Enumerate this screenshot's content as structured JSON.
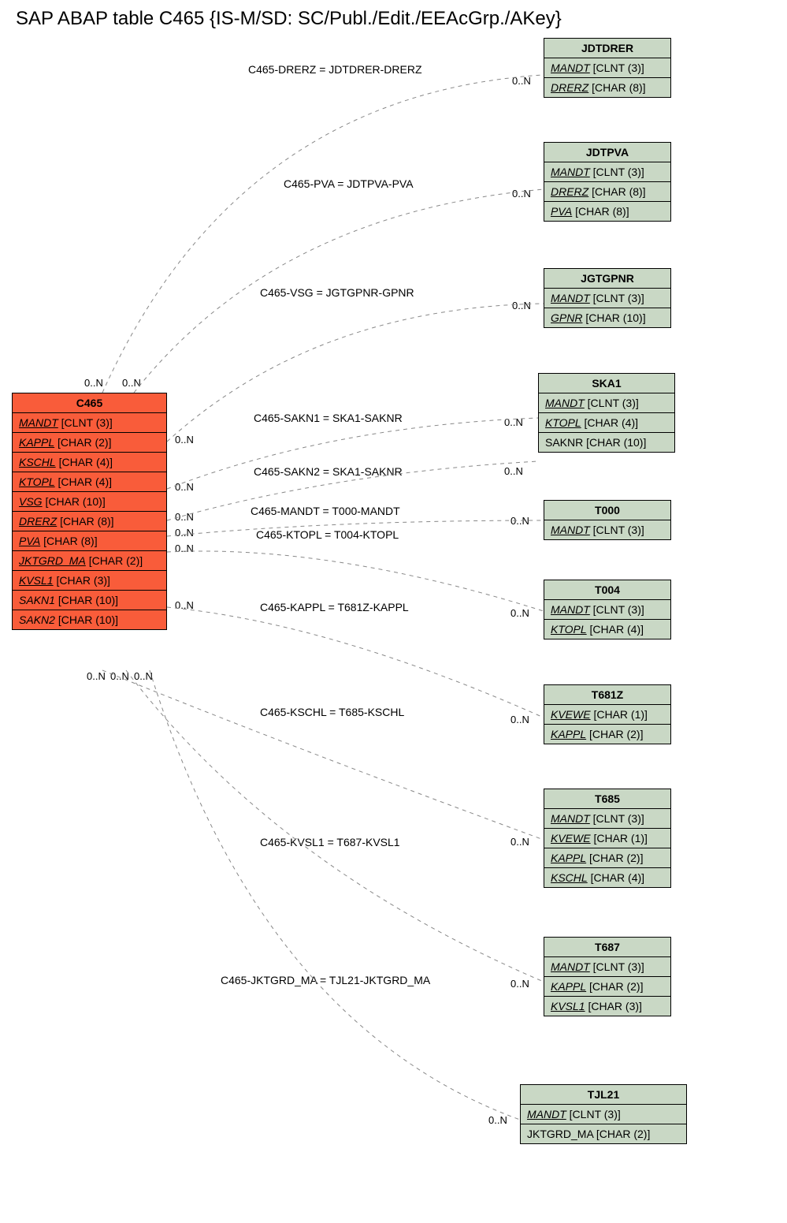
{
  "title": "SAP ABAP table C465 {IS-M/SD: SC/Publ./Edit./EEAcGrp./AKey}",
  "main_entity": {
    "name": "C465",
    "fields": [
      {
        "name": "MANDT",
        "type": "[CLNT (3)]",
        "key": true
      },
      {
        "name": "KAPPL",
        "type": "[CHAR (2)]",
        "key": true
      },
      {
        "name": "KSCHL",
        "type": "[CHAR (4)]",
        "key": true
      },
      {
        "name": "KTOPL",
        "type": "[CHAR (4)]",
        "key": true
      },
      {
        "name": "VSG",
        "type": "[CHAR (10)]",
        "key": true
      },
      {
        "name": "DRERZ",
        "type": "[CHAR (8)]",
        "key": true
      },
      {
        "name": "PVA",
        "type": "[CHAR (8)]",
        "key": true
      },
      {
        "name": "JKTGRD_MA",
        "type": "[CHAR (2)]",
        "key": true
      },
      {
        "name": "KVSL1",
        "type": "[CHAR (3)]",
        "key": true
      },
      {
        "name": "SAKN1",
        "type": "[CHAR (10)]",
        "key": false
      },
      {
        "name": "SAKN2",
        "type": "[CHAR (10)]",
        "key": false
      }
    ]
  },
  "related": [
    {
      "name": "JDTDRER",
      "fields": [
        {
          "name": "MANDT",
          "type": "[CLNT (3)]",
          "key": true
        },
        {
          "name": "DRERZ",
          "type": "[CHAR (8)]",
          "key": true
        }
      ]
    },
    {
      "name": "JDTPVA",
      "fields": [
        {
          "name": "MANDT",
          "type": "[CLNT (3)]",
          "key": true
        },
        {
          "name": "DRERZ",
          "type": "[CHAR (8)]",
          "key": true
        },
        {
          "name": "PVA",
          "type": "[CHAR (8)]",
          "key": true
        }
      ]
    },
    {
      "name": "JGTGPNR",
      "fields": [
        {
          "name": "MANDT",
          "type": "[CLNT (3)]",
          "key": true
        },
        {
          "name": "GPNR",
          "type": "[CHAR (10)]",
          "key": true
        }
      ]
    },
    {
      "name": "SKA1",
      "fields": [
        {
          "name": "MANDT",
          "type": "[CLNT (3)]",
          "key": true
        },
        {
          "name": "KTOPL",
          "type": "[CHAR (4)]",
          "key": true
        },
        {
          "name": "SAKNR",
          "type": "[CHAR (10)]",
          "key": false
        }
      ]
    },
    {
      "name": "T000",
      "fields": [
        {
          "name": "MANDT",
          "type": "[CLNT (3)]",
          "key": true
        }
      ]
    },
    {
      "name": "T004",
      "fields": [
        {
          "name": "MANDT",
          "type": "[CLNT (3)]",
          "key": true
        },
        {
          "name": "KTOPL",
          "type": "[CHAR (4)]",
          "key": true
        }
      ]
    },
    {
      "name": "T681Z",
      "fields": [
        {
          "name": "KVEWE",
          "type": "[CHAR (1)]",
          "key": true
        },
        {
          "name": "KAPPL",
          "type": "[CHAR (2)]",
          "key": true
        }
      ]
    },
    {
      "name": "T685",
      "fields": [
        {
          "name": "MANDT",
          "type": "[CLNT (3)]",
          "key": true
        },
        {
          "name": "KVEWE",
          "type": "[CHAR (1)]",
          "key": true
        },
        {
          "name": "KAPPL",
          "type": "[CHAR (2)]",
          "key": true
        },
        {
          "name": "KSCHL",
          "type": "[CHAR (4)]",
          "key": true
        }
      ]
    },
    {
      "name": "T687",
      "fields": [
        {
          "name": "MANDT",
          "type": "[CLNT (3)]",
          "key": true
        },
        {
          "name": "KAPPL",
          "type": "[CHAR (2)]",
          "key": true
        },
        {
          "name": "KVSL1",
          "type": "[CHAR (3)]",
          "key": true
        }
      ]
    },
    {
      "name": "TJL21",
      "fields": [
        {
          "name": "MANDT",
          "type": "[CLNT (3)]",
          "key": true
        },
        {
          "name": "JKTGRD_MA",
          "type": "[CHAR (2)]",
          "key": false
        }
      ]
    }
  ],
  "edges": [
    {
      "label": "C465-DRERZ = JDTDRER-DRERZ"
    },
    {
      "label": "C465-PVA = JDTPVA-PVA"
    },
    {
      "label": "C465-VSG = JGTGPNR-GPNR"
    },
    {
      "label": "C465-SAKN1 = SKA1-SAKNR"
    },
    {
      "label": "C465-SAKN2 = SKA1-SAKNR"
    },
    {
      "label": "C465-MANDT = T000-MANDT"
    },
    {
      "label": "C465-KTOPL = T004-KTOPL"
    },
    {
      "label": "C465-KAPPL = T681Z-KAPPL"
    },
    {
      "label": "C465-KSCHL = T685-KSCHL"
    },
    {
      "label": "C465-KVSL1 = T687-KVSL1"
    },
    {
      "label": "C465-JKTGRD_MA = TJL21-JKTGRD_MA"
    }
  ],
  "cardinality": "0..N"
}
